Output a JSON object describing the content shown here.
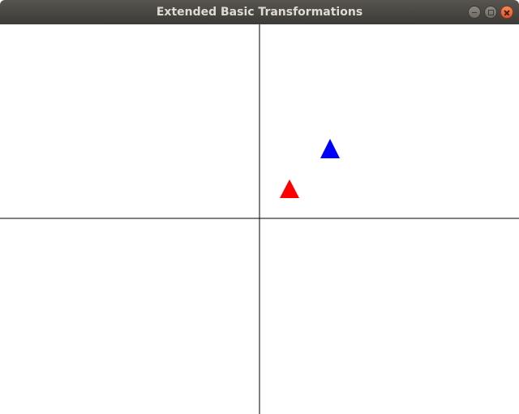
{
  "window": {
    "title": "Extended Basic Transformations"
  },
  "scene": {
    "triangles": [
      {
        "name": "red-triangle",
        "color": "#ff0000"
      },
      {
        "name": "blue-triangle",
        "color": "#0000ff"
      }
    ],
    "axis_color": "#000000",
    "background": "#ffffff"
  }
}
